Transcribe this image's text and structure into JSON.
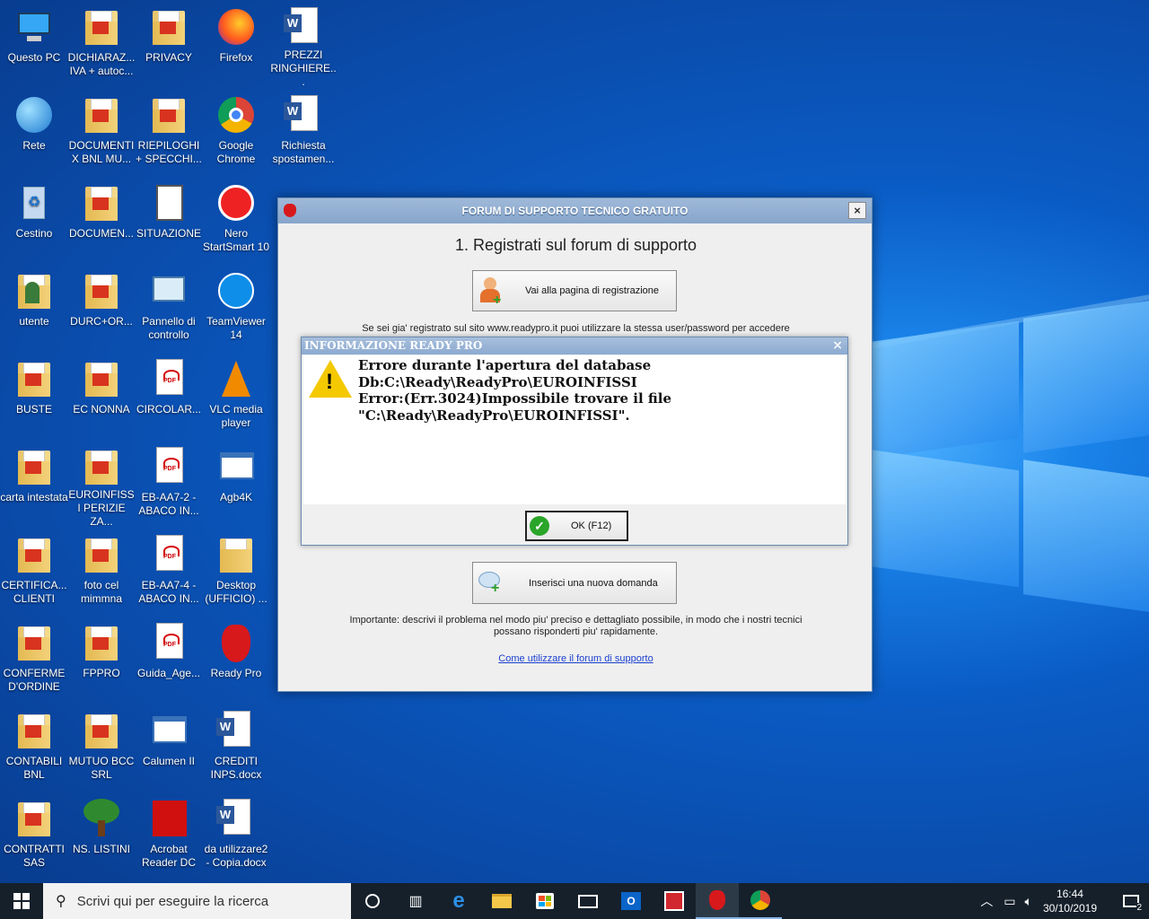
{
  "desktop": {
    "icons": [
      {
        "label": "Questo PC",
        "icon": "computer-icon"
      },
      {
        "label": "DICHIARAZ... IVA + autoc...",
        "icon": "folder-icon"
      },
      {
        "label": "PRIVACY",
        "icon": "folder-icon"
      },
      {
        "label": "Firefox",
        "icon": "firefox-icon"
      },
      {
        "label": "PREZZI RINGHIERE...",
        "icon": "word-icon"
      },
      {
        "label": "Rete",
        "icon": "network-icon"
      },
      {
        "label": "DOCUMENTI X BNL MU...",
        "icon": "folder-icon"
      },
      {
        "label": "RIEPILOGHI + SPECCHI...",
        "icon": "folder-icon"
      },
      {
        "label": "Google Chrome",
        "icon": "chrome-icon"
      },
      {
        "label": "Richiesta spostamen...",
        "icon": "word-icon"
      },
      {
        "label": "Cestino",
        "icon": "recycle-bin-icon"
      },
      {
        "label": "DOCUMEN...",
        "icon": "folder-icon"
      },
      {
        "label": "SITUAZIONE",
        "icon": "clipboard-icon"
      },
      {
        "label": "Nero StartSmart 10",
        "icon": "nero-icon"
      },
      {
        "label": "utente",
        "icon": "user-folder-icon"
      },
      {
        "label": "DURC+OR...",
        "icon": "folder-icon"
      },
      {
        "label": "Pannello di controllo",
        "icon": "control-panel-icon"
      },
      {
        "label": "TeamViewer 14",
        "icon": "teamviewer-icon"
      },
      {
        "label": "BUSTE",
        "icon": "folder-icon"
      },
      {
        "label": "EC NONNA",
        "icon": "folder-icon"
      },
      {
        "label": "CIRCOLAR...",
        "icon": "pdf-icon"
      },
      {
        "label": "VLC media player",
        "icon": "vlc-icon"
      },
      {
        "label": "carta intestata",
        "icon": "folder-icon"
      },
      {
        "label": "EUROINFISSI PERIZIE ZA...",
        "icon": "folder-icon"
      },
      {
        "label": "EB-AA7-2 - ABACO IN...",
        "icon": "pdf-icon"
      },
      {
        "label": "Agb4K",
        "icon": "window-icon"
      },
      {
        "label": "CERTIFICA... CLIENTI",
        "icon": "folder-icon"
      },
      {
        "label": "foto cel mimmna",
        "icon": "folder-icon"
      },
      {
        "label": "EB-AA7-4 - ABACO IN...",
        "icon": "pdf-icon"
      },
      {
        "label": "Desktop (UFFICIO) ...",
        "icon": "network-folder-icon"
      },
      {
        "label": "CONFERME D'ORDINE",
        "icon": "folder-icon"
      },
      {
        "label": "FPPRO",
        "icon": "folder-icon"
      },
      {
        "label": "Guida_Age...",
        "icon": "pdf-icon"
      },
      {
        "label": "Ready Pro",
        "icon": "strawberry-icon"
      },
      {
        "label": "CONTABILI BNL",
        "icon": "folder-icon"
      },
      {
        "label": "MUTUO BCC SRL",
        "icon": "folder-icon"
      },
      {
        "label": "Calumen II",
        "icon": "window-icon"
      },
      {
        "label": "CREDITI INPS.docx",
        "icon": "word-icon"
      },
      {
        "label": "CONTRATTI SAS",
        "icon": "folder-icon"
      },
      {
        "label": "NS. LISTINI",
        "icon": "tree-icon"
      },
      {
        "label": "Acrobat Reader DC",
        "icon": "acrobat-icon"
      },
      {
        "label": "da utilizzare2 - Copia.docx",
        "icon": "word-icon"
      }
    ]
  },
  "support_window": {
    "title": "FORUM DI SUPPORTO TECNICO GRATUITO",
    "close_label": "×",
    "heading": "1. Registrati sul forum di supporto",
    "register_button": "Vai alla pagina di registrazione",
    "already_registered": "Se sei gia' registrato sul sito www.readypro.it puoi utilizzare la stessa user/password per accedere",
    "new_question_button": "Inserisci una nuova domanda",
    "important_line1": "Importante: descrivi il problema nel modo piu' preciso e dettagliato possibile, in modo che i nostri tecnici",
    "important_line2": "possano risponderti piu' rapidamente.",
    "howto_link": "Come utilizzare il forum di supporto"
  },
  "error_dialog": {
    "title": "INFORMAZIONE READY PRO",
    "close_label": "×",
    "message_line1": "Errore durante l'apertura del database",
    "message_line2": "Db:C:\\Ready\\ReadyPro\\EUROINFISSI",
    "message_line3": "Error:(Err.3024)Impossibile trovare il file",
    "message_line4": "\"C:\\Ready\\ReadyPro\\EUROINFISSI\".",
    "ok_button": "OK (F12)"
  },
  "taskbar": {
    "search_placeholder": "Scrivi qui per eseguire la ricerca",
    "time": "16:44",
    "date": "30/10/2019",
    "notification_count": "2"
  },
  "colors": {
    "taskbar": "#15202b",
    "title_bar": "#8caad0",
    "link": "#1a3fcf"
  }
}
